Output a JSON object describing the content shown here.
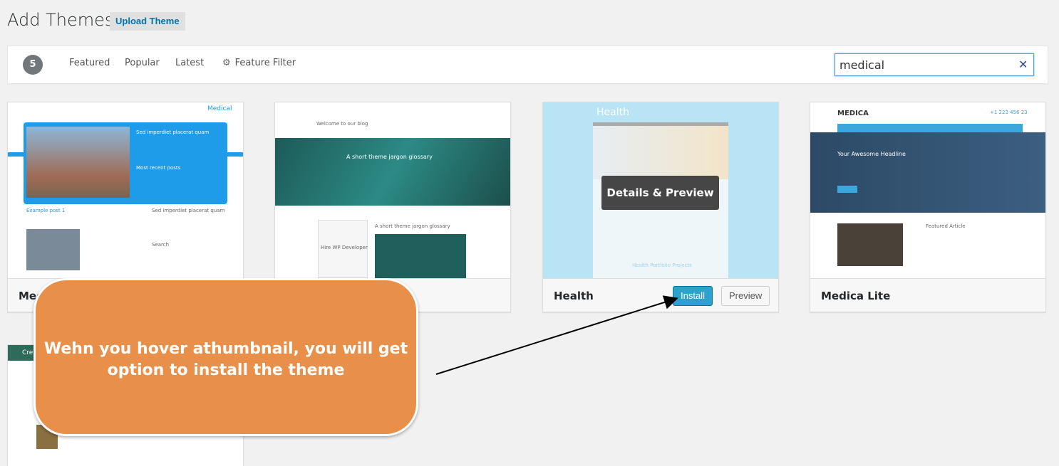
{
  "header": {
    "title": "Add Themes",
    "upload_label": "Upload Theme"
  },
  "filter": {
    "count": "5",
    "tabs": [
      "Featured",
      "Popular",
      "Latest"
    ],
    "feature_filter": "Feature Filter",
    "search_value": "medical",
    "clear_icon": "close-icon"
  },
  "themes": [
    {
      "name": "Medi",
      "thumb": {
        "brand": "Medical",
        "heading": "Sed imperdiet placerat quam",
        "sub": "Most recent posts",
        "post": "Example post 1",
        "search": "Search"
      }
    },
    {
      "name": "",
      "thumb": {
        "hero": "A short theme jargon glossary",
        "welcome": "Welcome to our blog",
        "widget": "Hire WP Developer"
      }
    },
    {
      "name": "Health",
      "hover_label": "Details & Preview",
      "install_label": "Install",
      "preview_label": "Preview",
      "thumb": {
        "brand": "Health",
        "footer": "Health Portfolio Projects"
      }
    },
    {
      "name": "Medica Lite",
      "thumb": {
        "brand": "MEDICA",
        "phone": "+1 223 456 23",
        "headline": "Your Awesome Headline",
        "article": "Featured Article"
      }
    },
    {
      "name": "",
      "thumb": {
        "brand": "Cre"
      }
    }
  ],
  "callout": {
    "text": "Wehn you hover athumbnail, you will get option to install the theme"
  },
  "colors": {
    "accent": "#0073aa",
    "install": "#2ea2cc",
    "callout": "#e8904a"
  }
}
